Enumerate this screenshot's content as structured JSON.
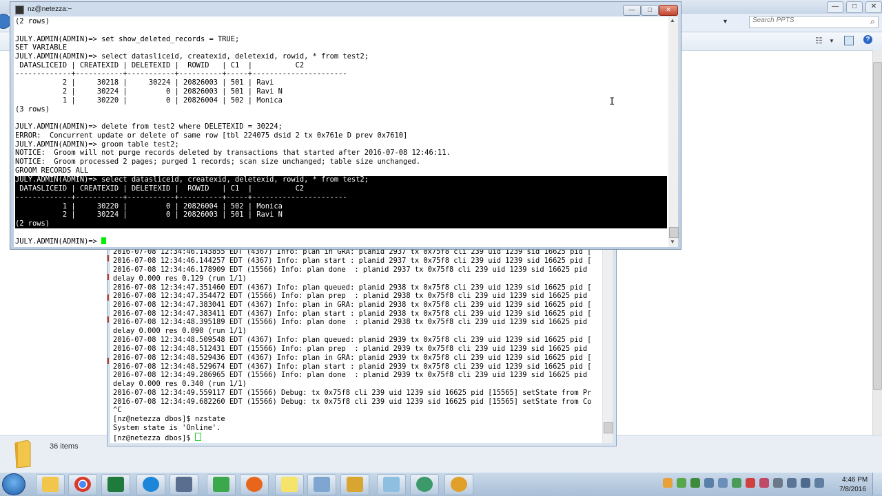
{
  "explorer": {
    "search_placeholder": "Search PPTS",
    "items_count": "36 items",
    "controls": {
      "minimize": "—",
      "maximize": "□",
      "close": "✕"
    }
  },
  "terminal_main": {
    "title": "nz@netezza:~",
    "controls": {
      "minimize": "—",
      "maximize": "□",
      "close": "✕"
    },
    "lines": [
      "(2 rows)",
      "",
      "JULY.ADMIN(ADMIN)=> set show_deleted_records = TRUE;",
      "SET VARIABLE",
      "JULY.ADMIN(ADMIN)=> select datasliceid, createxid, deletexid, rowid, * from test2;",
      " DATASLICEID | CREATEXID | DELETEXID |  ROWID   | C1  |          C2",
      "-------------+-----------+-----------+----------+-----+----------------------",
      "           2 |     30218 |     30224 | 20826003 | 501 | Ravi",
      "           2 |     30224 |         0 | 20826003 | 501 | Ravi N",
      "           1 |     30220 |         0 | 20826004 | 502 | Monica",
      "(3 rows)",
      "",
      "JULY.ADMIN(ADMIN)=> delete from test2 where DELETEXID = 30224;",
      "ERROR:  Concurrent update or delete of same row [tbl 224075 dsid 2 tx 0x761e D prev 0x7610]",
      "JULY.ADMIN(ADMIN)=> groom table test2;",
      "NOTICE:  Groom will not purge records deleted by transactions that started after 2016-07-08 12:46:11.",
      "NOTICE:  Groom processed 2 pages; purged 1 records; scan size unchanged; table size unchanged.",
      "GROOM RECORDS ALL"
    ],
    "highlighted_lines": [
      "JULY.ADMIN(ADMIN)=> select datasliceid, createxid, deletexid, rowid, * from test2;",
      " DATASLICEID | CREATEXID | DELETEXID |  ROWID   | C1  |          C2",
      "-------------+-----------+-----------+----------+-----+----------------------",
      "           1 |     30220 |         0 | 20826004 | 502 | Monica",
      "           2 |     30224 |         0 | 20826003 | 501 | Ravi N",
      "(2 rows)"
    ],
    "prompt": "JULY.ADMIN(ADMIN)=> "
  },
  "terminal_log": {
    "lines": [
      "2016-07-08 12:34:46.143855 EDT (4367) Info: plan in GRA: planid 2937 tx 0x75f8 cli 239 uid 1239 sid 16625 pid [",
      "2016-07-08 12:34:46.144257 EDT (4367) Info: plan start : planid 2937 tx 0x75f8 cli 239 uid 1239 sid 16625 pid [",
      "2016-07-08 12:34:46.178909 EDT (15566) Info: plan done  : planid 2937 tx 0x75f8 cli 239 uid 1239 sid 16625 pid",
      "delay 0.000 res 0.129 (run 1/1)",
      "2016-07-08 12:34:47.351460 EDT (4367) Info: plan queued: planid 2938 tx 0x75f8 cli 239 uid 1239 sid 16625 pid [",
      "2016-07-08 12:34:47.354472 EDT (15566) Info: plan prep  : planid 2938 tx 0x75f8 cli 239 uid 1239 sid 16625 pid",
      "2016-07-08 12:34:47.383041 EDT (4367) Info: plan in GRA: planid 2938 tx 0x75f8 cli 239 uid 1239 sid 16625 pid [",
      "2016-07-08 12:34:47.383411 EDT (4367) Info: plan start : planid 2938 tx 0x75f8 cli 239 uid 1239 sid 16625 pid [",
      "2016-07-08 12:34:48.395189 EDT (15566) Info: plan done  : planid 2938 tx 0x75f8 cli 239 uid 1239 sid 16625 pid",
      "delay 0.000 res 0.090 (run 1/1)",
      "2016-07-08 12:34:48.509548 EDT (4367) Info: plan queued: planid 2939 tx 0x75f8 cli 239 uid 1239 sid 16625 pid [",
      "2016-07-08 12:34:48.512431 EDT (15566) Info: plan prep  : planid 2939 tx 0x75f8 cli 239 uid 1239 sid 16625 pid",
      "2016-07-08 12:34:48.529436 EDT (4367) Info: plan in GRA: planid 2939 tx 0x75f8 cli 239 uid 1239 sid 16625 pid [",
      "2016-07-08 12:34:48.529674 EDT (4367) Info: plan start : planid 2939 tx 0x75f8 cli 239 uid 1239 sid 16625 pid [",
      "2016-07-08 12:34:49.286965 EDT (15566) Info: plan done  : planid 2939 tx 0x75f8 cli 239 uid 1239 sid 16625 pid",
      "delay 0.000 res 0.340 (run 1/1)",
      "2016-07-08 12:34:49.559117 EDT (15566) Debug: tx 0x75f8 cli 239 uid 1239 sid 16625 pid [15565] setState from Pr",
      "2016-07-08 12:34:49.682260 EDT (15566) Debug: tx 0x75f8 cli 239 uid 1239 sid 16625 pid [15565] setState from Co",
      "^C",
      "[nz@netezza dbos]$ nzstate",
      "System state is 'Online'."
    ],
    "prompt": "[nz@netezza dbos]$ "
  },
  "taskbar": {
    "time": "4:46 PM",
    "date": "7/8/2016",
    "apps": [
      "windows-explorer",
      "chrome",
      "excel",
      "internet-explorer",
      "network-app",
      "video-app",
      "firefox",
      "sticky-notes",
      "snipping-tool",
      "file-manager",
      "document-app",
      "sync-app",
      "settings-app"
    ],
    "colors": {
      "chrome": "#d83b2a",
      "excel": "#1f7a3b",
      "firefox": "#e8661c",
      "ie": "#1d86d8"
    }
  }
}
